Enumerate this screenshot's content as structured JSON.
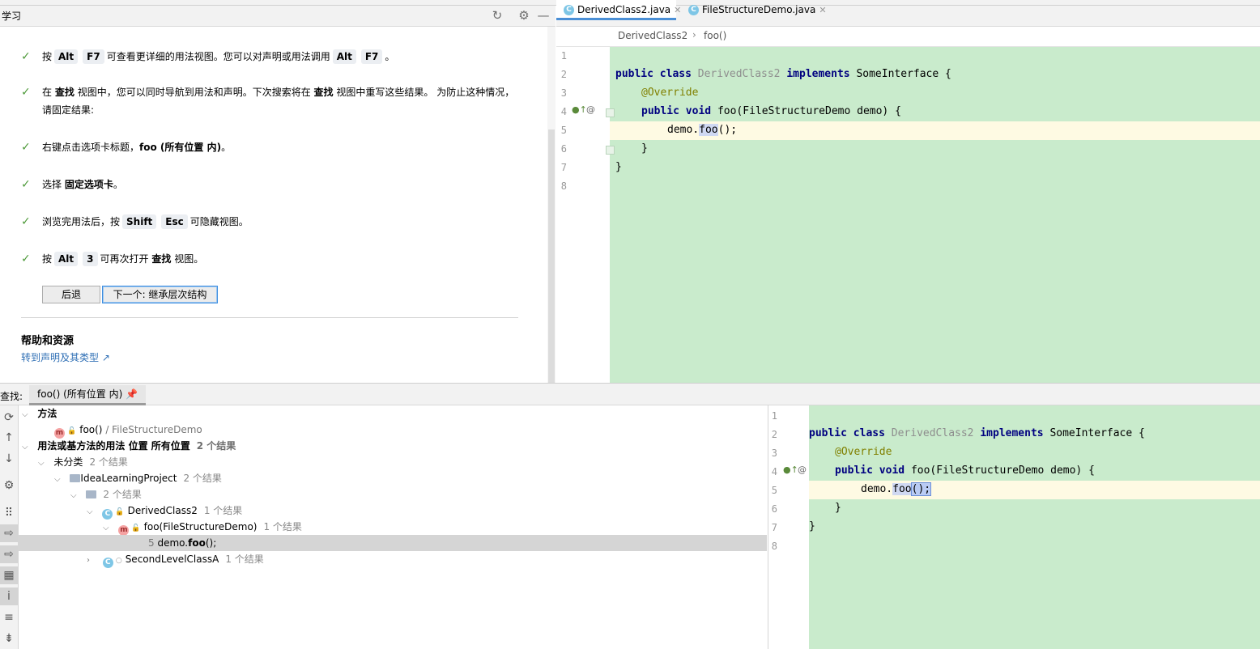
{
  "learn_panel": {
    "title": "学习",
    "steps": [
      {
        "parts": [
          "按",
          "Alt",
          "F7",
          "可查看更详细的用法视图。您可以对声明或用法调用",
          "Alt",
          "F7",
          "。"
        ]
      },
      {
        "line1_a": "在",
        "line1_b": "查找",
        "line1_c": "视图中，您可以同时导航到用法和声明。下次搜索将在",
        "line1_d": "查找",
        "line1_e": "视图中重写这些结果。 为防止这种情况，",
        "line2": "请固定结果:"
      },
      {
        "a": "右键点击选项卡标题，",
        "b": "foo (所有位置 内)",
        "c": "。"
      },
      {
        "a": "选择",
        "b": "固定选项卡",
        "c": "。"
      },
      {
        "a": "浏览完用法后，按",
        "k1": "Shift",
        "k2": "Esc",
        "c": "可隐藏视图。"
      },
      {
        "a": "按",
        "k1": "Alt",
        "k2": "3",
        "b": "可再次打开",
        "c": "查找",
        "d": "视图。"
      }
    ],
    "back_button": "后退",
    "next_button": "下一个: 继承层次结构",
    "help_title": "帮助和资源",
    "help_link": "转到声明及其类型 ↗"
  },
  "editor": {
    "tabs": [
      {
        "label": "DerivedClass2.java",
        "active": true
      },
      {
        "label": "FileStructureDemo.java",
        "active": false
      }
    ],
    "breadcrumb": [
      "DerivedClass2",
      "foo()"
    ],
    "line_numbers": [
      "1",
      "2",
      "3",
      "4",
      "5",
      "6",
      "7",
      "8"
    ],
    "code": {
      "kw_public": "public",
      "kw_class": "class",
      "class_name": "DerivedClass2",
      "kw_implements": "implements",
      "iface": "SomeInterface {",
      "annotation": "@Override",
      "kw_void": "void",
      "method_sig": "foo(FileStructureDemo demo) {",
      "call_obj": "demo.",
      "call_method": "foo",
      "call_args": "();",
      "close_method": "}",
      "close_class": "}"
    }
  },
  "find_panel": {
    "label": "查找:",
    "tab_label": "foo() (所有位置 内)",
    "tree": {
      "methods_header": "方法",
      "method_item": "foo()",
      "method_item_path": "/ FileStructureDemo",
      "usages_header": "用法或基方法的用法 位置 所有位置",
      "usages_count": "2 个结果",
      "uncategorized": "未分类",
      "uncategorized_count": "2 个结果",
      "project": "IdeaLearningProject",
      "project_count": "2 个结果",
      "pkg_count": "2 个结果",
      "class1": "DerivedClass2",
      "class1_count": "1 个结果",
      "method1": "foo(FileStructureDemo)",
      "method1_count": "1 个结果",
      "usage_line": "5",
      "usage_obj": "demo.",
      "usage_method": "foo",
      "usage_rest": "();",
      "class2": "SecondLevelClassA",
      "class2_count": "1 个结果"
    }
  },
  "colors": {
    "code_bg": "#c9ebcc",
    "caret_line": "#fefae3",
    "keyword": "#000080",
    "annotation": "#808000",
    "link": "#2f6fb5",
    "check": "#4e9a3a"
  }
}
